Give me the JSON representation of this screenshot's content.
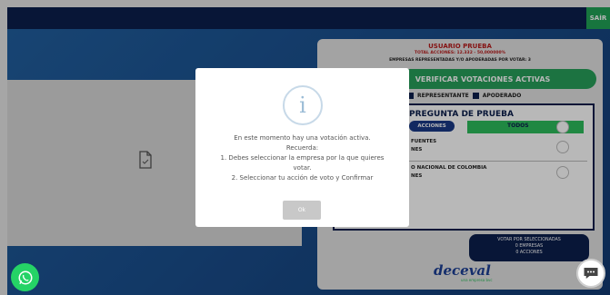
{
  "header": {
    "exit_label": "SAÍR"
  },
  "right_panel": {
    "user_title": "USUARIO PRUEBA",
    "user_line1": "TOTAL ACCIONES: 12.332 - 50,000000%",
    "user_line2": "EMPRESAS REPRESENTADAS Y/O APODERADAS POR VOTAR: 3",
    "verify_label": "VERIFICAR VOTACIONES ACTIVAS",
    "legend": {
      "representante": "REPRESENTANTE",
      "apoderado": "APODERADO"
    },
    "question": {
      "title": "PREGUNTA DE PRUEBA",
      "acciones_label": "ACCIONES",
      "todos_label": "TODOS",
      "companies": [
        {
          "line1": "FUENTES",
          "line2": "NES"
        },
        {
          "line1": "O NACIONAL DE COLOMBIA",
          "line2": "NES"
        }
      ]
    },
    "summary": {
      "line1": "VOTAR POR SELECCIONADAS",
      "line2": "0 EMPRESAS",
      "line3": "0 ACCIONES"
    },
    "brand": "deceval",
    "brand_sub": "una empresa bvc"
  },
  "modal": {
    "icon": "info-icon",
    "lines": [
      "En este momento hay una votación activa.",
      "Recuerda:",
      "1. Debes seleccionar la empresa por la que quieres",
      "votar.",
      "2. Seleccionar tu acción de voto y Confirmar"
    ],
    "ok_label": "Ok"
  },
  "icons": {
    "whatsapp": "whatsapp-icon",
    "chat": "chat-icon",
    "document": "document-icon"
  },
  "colors": {
    "navy": "#0c1f4d",
    "green": "#27a05b",
    "red": "#b91c1c"
  }
}
